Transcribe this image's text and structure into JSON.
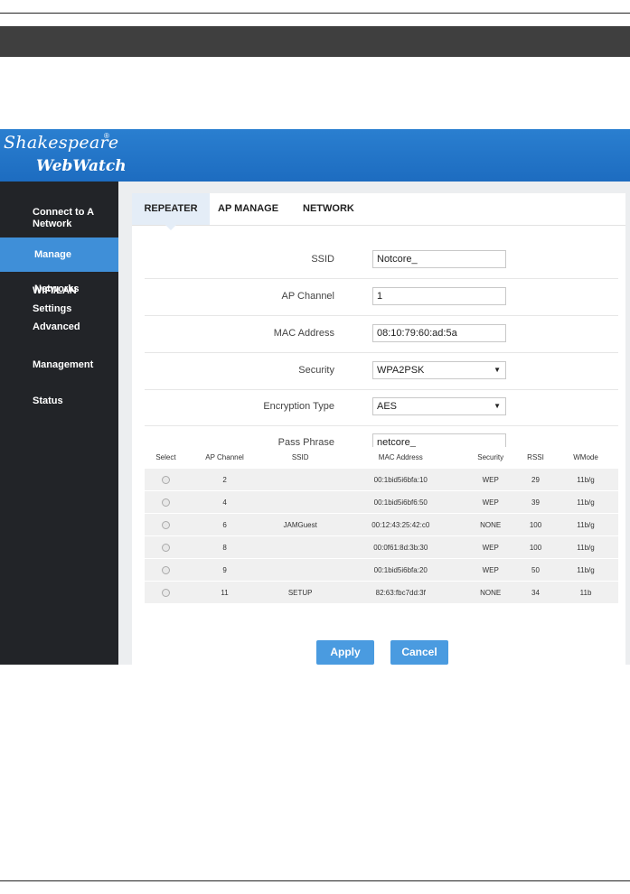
{
  "brand": {
    "line1": "Shakespeare",
    "reg": "®",
    "line2": "WebWatch"
  },
  "sidebar": {
    "items": [
      {
        "label_line1": "Connect to A",
        "label_line2": "Network"
      },
      {
        "label": "Manage Networks"
      },
      {
        "label": "WIFI/LAN Settings"
      },
      {
        "label": "Advanced"
      },
      {
        "label": "Management"
      },
      {
        "label": "Status"
      }
    ]
  },
  "tabs": [
    "REPEATER",
    "AP MANAGE",
    "NETWORK"
  ],
  "form": {
    "ssid_label": "SSID",
    "ssid_value": "Notcore_",
    "channel_label": "AP Channel",
    "channel_value": "1",
    "mac_label": "MAC Address",
    "mac_value": "08:10:79:60:ad:5a",
    "security_label": "Security",
    "security_value": "WPA2PSK",
    "encryption_label": "Encryption Type",
    "encryption_value": "AES",
    "passphrase_label": "Pass Phrase",
    "passphrase_value": "netcore_"
  },
  "ap_table": {
    "headers": [
      "Select",
      "AP Channel",
      "SSID",
      "MAC Address",
      "Security",
      "RSSI",
      "WMode"
    ],
    "rows": [
      {
        "channel": "2",
        "ssid": "",
        "mac": "00:1bid5i6bfa:10",
        "security": "WEP",
        "rssi": "29",
        "wmode": "11b/g"
      },
      {
        "channel": "4",
        "ssid": "",
        "mac": "00:1bid5i6bf6:50",
        "security": "WEP",
        "rssi": "39",
        "wmode": "11b/g"
      },
      {
        "channel": "6",
        "ssid": "JAMGuest",
        "mac": "00:12:43:25:42:c0",
        "security": "NONE",
        "rssi": "100",
        "wmode": "11b/g"
      },
      {
        "channel": "8",
        "ssid": "",
        "mac": "00:0f61:8d:3b:30",
        "security": "WEP",
        "rssi": "100",
        "wmode": "11b/g"
      },
      {
        "channel": "9",
        "ssid": "",
        "mac": "00:1bid5i6bfa:20",
        "security": "WEP",
        "rssi": "50",
        "wmode": "11b/g"
      },
      {
        "channel": "11",
        "ssid": "SETUP",
        "mac": "82:63:fbc7dd:3f",
        "security": "NONE",
        "rssi": "34",
        "wmode": "11b"
      }
    ]
  },
  "buttons": {
    "apply": "Apply",
    "cancel": "Cancel"
  },
  "colors": {
    "header_blue": "#2a7fd0",
    "sidebar": "#222428",
    "active_nav": "#3f8fd8",
    "button": "#4a9be0"
  },
  "icons": {
    "dropdown": "triangle-down-icon",
    "radio": "radio-button-icon"
  }
}
